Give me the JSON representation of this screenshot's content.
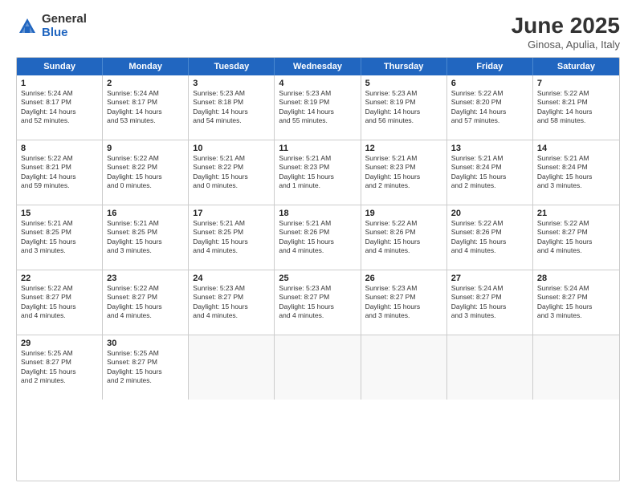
{
  "header": {
    "logo_general": "General",
    "logo_blue": "Blue",
    "month_title": "June 2025",
    "location": "Ginosa, Apulia, Italy"
  },
  "days_of_week": [
    "Sunday",
    "Monday",
    "Tuesday",
    "Wednesday",
    "Thursday",
    "Friday",
    "Saturday"
  ],
  "weeks": [
    [
      {
        "day": "1",
        "info": "Sunrise: 5:24 AM\nSunset: 8:17 PM\nDaylight: 14 hours\nand 52 minutes."
      },
      {
        "day": "2",
        "info": "Sunrise: 5:24 AM\nSunset: 8:17 PM\nDaylight: 14 hours\nand 53 minutes."
      },
      {
        "day": "3",
        "info": "Sunrise: 5:23 AM\nSunset: 8:18 PM\nDaylight: 14 hours\nand 54 minutes."
      },
      {
        "day": "4",
        "info": "Sunrise: 5:23 AM\nSunset: 8:19 PM\nDaylight: 14 hours\nand 55 minutes."
      },
      {
        "day": "5",
        "info": "Sunrise: 5:23 AM\nSunset: 8:19 PM\nDaylight: 14 hours\nand 56 minutes."
      },
      {
        "day": "6",
        "info": "Sunrise: 5:22 AM\nSunset: 8:20 PM\nDaylight: 14 hours\nand 57 minutes."
      },
      {
        "day": "7",
        "info": "Sunrise: 5:22 AM\nSunset: 8:21 PM\nDaylight: 14 hours\nand 58 minutes."
      }
    ],
    [
      {
        "day": "8",
        "info": "Sunrise: 5:22 AM\nSunset: 8:21 PM\nDaylight: 14 hours\nand 59 minutes."
      },
      {
        "day": "9",
        "info": "Sunrise: 5:22 AM\nSunset: 8:22 PM\nDaylight: 15 hours\nand 0 minutes."
      },
      {
        "day": "10",
        "info": "Sunrise: 5:21 AM\nSunset: 8:22 PM\nDaylight: 15 hours\nand 0 minutes."
      },
      {
        "day": "11",
        "info": "Sunrise: 5:21 AM\nSunset: 8:23 PM\nDaylight: 15 hours\nand 1 minute."
      },
      {
        "day": "12",
        "info": "Sunrise: 5:21 AM\nSunset: 8:23 PM\nDaylight: 15 hours\nand 2 minutes."
      },
      {
        "day": "13",
        "info": "Sunrise: 5:21 AM\nSunset: 8:24 PM\nDaylight: 15 hours\nand 2 minutes."
      },
      {
        "day": "14",
        "info": "Sunrise: 5:21 AM\nSunset: 8:24 PM\nDaylight: 15 hours\nand 3 minutes."
      }
    ],
    [
      {
        "day": "15",
        "info": "Sunrise: 5:21 AM\nSunset: 8:25 PM\nDaylight: 15 hours\nand 3 minutes."
      },
      {
        "day": "16",
        "info": "Sunrise: 5:21 AM\nSunset: 8:25 PM\nDaylight: 15 hours\nand 3 minutes."
      },
      {
        "day": "17",
        "info": "Sunrise: 5:21 AM\nSunset: 8:25 PM\nDaylight: 15 hours\nand 4 minutes."
      },
      {
        "day": "18",
        "info": "Sunrise: 5:21 AM\nSunset: 8:26 PM\nDaylight: 15 hours\nand 4 minutes."
      },
      {
        "day": "19",
        "info": "Sunrise: 5:22 AM\nSunset: 8:26 PM\nDaylight: 15 hours\nand 4 minutes."
      },
      {
        "day": "20",
        "info": "Sunrise: 5:22 AM\nSunset: 8:26 PM\nDaylight: 15 hours\nand 4 minutes."
      },
      {
        "day": "21",
        "info": "Sunrise: 5:22 AM\nSunset: 8:27 PM\nDaylight: 15 hours\nand 4 minutes."
      }
    ],
    [
      {
        "day": "22",
        "info": "Sunrise: 5:22 AM\nSunset: 8:27 PM\nDaylight: 15 hours\nand 4 minutes."
      },
      {
        "day": "23",
        "info": "Sunrise: 5:22 AM\nSunset: 8:27 PM\nDaylight: 15 hours\nand 4 minutes."
      },
      {
        "day": "24",
        "info": "Sunrise: 5:23 AM\nSunset: 8:27 PM\nDaylight: 15 hours\nand 4 minutes."
      },
      {
        "day": "25",
        "info": "Sunrise: 5:23 AM\nSunset: 8:27 PM\nDaylight: 15 hours\nand 4 minutes."
      },
      {
        "day": "26",
        "info": "Sunrise: 5:23 AM\nSunset: 8:27 PM\nDaylight: 15 hours\nand 3 minutes."
      },
      {
        "day": "27",
        "info": "Sunrise: 5:24 AM\nSunset: 8:27 PM\nDaylight: 15 hours\nand 3 minutes."
      },
      {
        "day": "28",
        "info": "Sunrise: 5:24 AM\nSunset: 8:27 PM\nDaylight: 15 hours\nand 3 minutes."
      }
    ],
    [
      {
        "day": "29",
        "info": "Sunrise: 5:25 AM\nSunset: 8:27 PM\nDaylight: 15 hours\nand 2 minutes."
      },
      {
        "day": "30",
        "info": "Sunrise: 5:25 AM\nSunset: 8:27 PM\nDaylight: 15 hours\nand 2 minutes."
      },
      {
        "day": "",
        "info": ""
      },
      {
        "day": "",
        "info": ""
      },
      {
        "day": "",
        "info": ""
      },
      {
        "day": "",
        "info": ""
      },
      {
        "day": "",
        "info": ""
      }
    ]
  ]
}
